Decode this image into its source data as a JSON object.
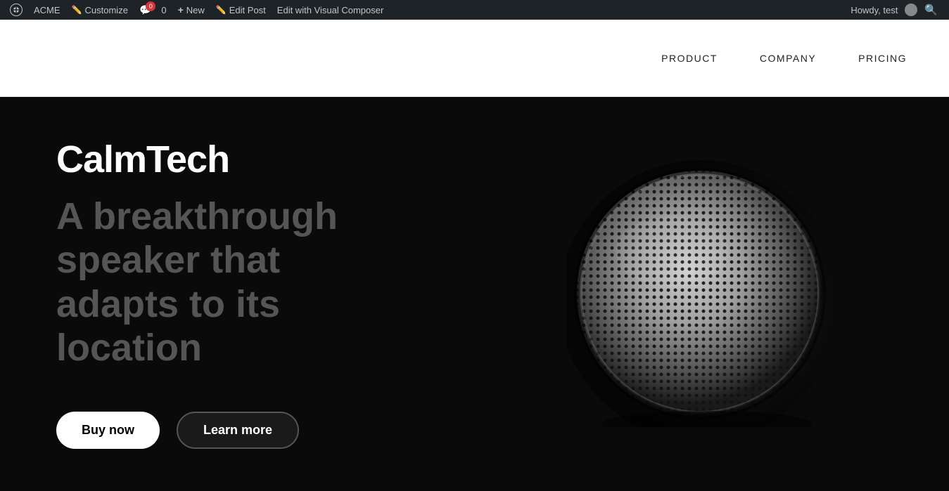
{
  "admin_bar": {
    "wp_label": "WordPress",
    "acme_label": "ACME",
    "customize_label": "Customize",
    "comment_count": "0",
    "new_label": "New",
    "edit_post_label": "Edit Post",
    "visual_composer_label": "Edit with Visual Composer",
    "howdy": "Howdy, test",
    "search_label": "Search"
  },
  "nav": {
    "product_label": "PRODUCT",
    "company_label": "COMPANY",
    "pricing_label": "PRICING"
  },
  "hero": {
    "brand": "CalmTech",
    "tagline": "A breakthrough speaker that adapts to its location",
    "buy_label": "Buy now",
    "learn_label": "Learn more"
  }
}
